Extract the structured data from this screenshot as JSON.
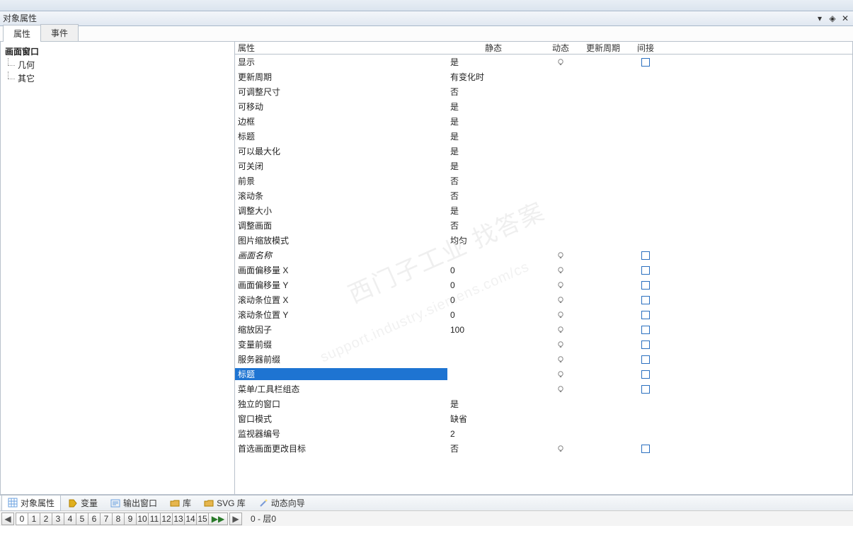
{
  "panel": {
    "title": "对象属性"
  },
  "title_controls": {
    "dropdown": "▾",
    "pin": "◈",
    "close": "✕"
  },
  "tabs": [
    {
      "label": "属性",
      "active": true
    },
    {
      "label": "事件",
      "active": false
    }
  ],
  "tree": {
    "root": "画面窗口",
    "children": [
      "几何",
      "其它"
    ]
  },
  "grid": {
    "headers": {
      "prop": "属性",
      "static": "静态",
      "dynamic": "动态",
      "period": "更新周期",
      "indirect": "间接"
    },
    "rows": [
      {
        "prop": "显示",
        "static": "是",
        "bulb": true,
        "chk": true
      },
      {
        "prop": "更新周期",
        "static": "有变化时"
      },
      {
        "prop": "可调整尺寸",
        "static": "否"
      },
      {
        "prop": "可移动",
        "static": "是"
      },
      {
        "prop": "边框",
        "static": "是"
      },
      {
        "prop": "标题",
        "static": "是"
      },
      {
        "prop": "可以最大化",
        "static": "是"
      },
      {
        "prop": "可关闭",
        "static": "是"
      },
      {
        "prop": "前景",
        "static": "否"
      },
      {
        "prop": "滚动条",
        "static": "否"
      },
      {
        "prop": "调整大小",
        "static": "是"
      },
      {
        "prop": "调整画面",
        "static": "否"
      },
      {
        "prop": "图片缩放模式",
        "static": "均匀"
      },
      {
        "prop": "画面名称",
        "static": "",
        "bulb": true,
        "chk": true,
        "italic": true
      },
      {
        "prop": "画面偏移量 X",
        "static": "0",
        "bulb": true,
        "chk": true
      },
      {
        "prop": "画面偏移量 Y",
        "static": "0",
        "bulb": true,
        "chk": true
      },
      {
        "prop": "滚动条位置 X",
        "static": "0",
        "bulb": true,
        "chk": true
      },
      {
        "prop": "滚动条位置 Y",
        "static": "0",
        "bulb": true,
        "chk": true
      },
      {
        "prop": "缩放因子",
        "static": "100",
        "bulb": true,
        "chk": true
      },
      {
        "prop": "变量前缀",
        "static": "",
        "bulb": true,
        "chk": true
      },
      {
        "prop": "服务器前缀",
        "static": "",
        "bulb": true,
        "chk": true
      },
      {
        "prop": "标题",
        "static": "",
        "bulb": true,
        "chk": true,
        "selected": true
      },
      {
        "prop": "菜单/工具栏组态",
        "static": "",
        "bulb": true,
        "chk": true
      },
      {
        "prop": "独立的窗口",
        "static": "是"
      },
      {
        "prop": "窗口模式",
        "static": "缺省"
      },
      {
        "prop": "监视器编号",
        "static": "2"
      },
      {
        "prop": "首选画面更改目标",
        "static": "否",
        "bulb": true,
        "chk": true
      }
    ]
  },
  "bottom_tabs": [
    {
      "label": "对象属性",
      "icon": "grid",
      "color": "#6aa0e0",
      "active": true
    },
    {
      "label": "变量",
      "icon": "tag",
      "color": "#e0b020"
    },
    {
      "label": "输出窗口",
      "icon": "out",
      "color": "#6aa0e0"
    },
    {
      "label": "库",
      "icon": "folder",
      "color": "#e6b64e"
    },
    {
      "label": "SVG 库",
      "icon": "folder",
      "color": "#e6b64e"
    },
    {
      "label": "动态向导",
      "icon": "wand",
      "color": "#7a9ad6"
    }
  ],
  "layer_bar": {
    "nav_back": "◀",
    "nav_fwd": "▶",
    "cells": [
      "0",
      "1",
      "2",
      "3",
      "4",
      "5",
      "6",
      "7",
      "8",
      "9",
      "10",
      "11",
      "12",
      "13",
      "14",
      "15"
    ],
    "selected_index": 0,
    "next": "▶▶",
    "label": "0 - 层0"
  },
  "watermark": {
    "line1": "西门子工业 找答案",
    "line2": "support.industry.siemens.com/cs"
  }
}
